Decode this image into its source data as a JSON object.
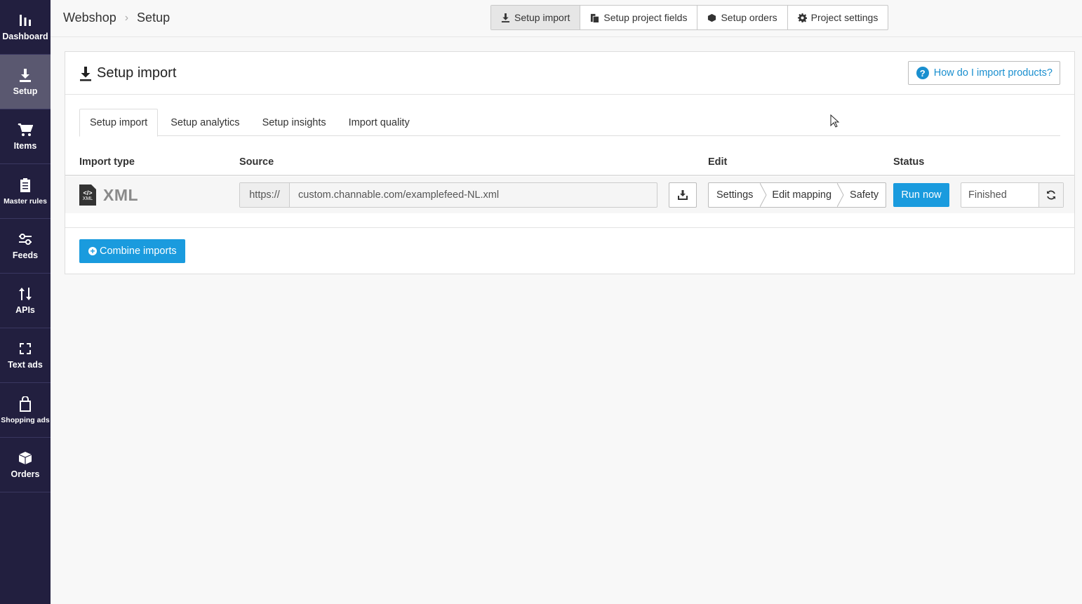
{
  "sidebar": {
    "items": [
      {
        "label": "Dashboard",
        "icon": "bar-chart-icon"
      },
      {
        "label": "Setup",
        "icon": "download-icon",
        "active": true
      },
      {
        "label": "Items",
        "icon": "cart-icon"
      },
      {
        "label": "Master rules",
        "icon": "clipboard-icon"
      },
      {
        "label": "Feeds",
        "icon": "sliders-icon"
      },
      {
        "label": "APIs",
        "icon": "arrows-updown-icon"
      },
      {
        "label": "Text ads",
        "icon": "expand-icon"
      },
      {
        "label": "Shopping ads",
        "icon": "shopping-bag-icon"
      },
      {
        "label": "Orders",
        "icon": "box-icon"
      }
    ]
  },
  "breadcrumb": {
    "root": "Webshop",
    "current": "Setup"
  },
  "topnav": {
    "setup_import": "Setup import",
    "setup_project_fields": "Setup project fields",
    "setup_orders": "Setup orders",
    "project_settings": "Project settings"
  },
  "panel": {
    "title": "Setup import",
    "help_label": "How do I import products?",
    "tabs": [
      "Setup import",
      "Setup analytics",
      "Setup insights",
      "Import quality"
    ],
    "columns": {
      "import_type": "Import type",
      "source": "Source",
      "edit": "Edit",
      "status": "Status"
    },
    "row": {
      "file_code": "</>",
      "file_label": "XML",
      "type": "XML",
      "source_prefix": "https://",
      "source_url": "custom.channable.com/examplefeed-NL.xml",
      "edit_settings": "Settings",
      "edit_mapping": "Edit mapping",
      "edit_safety": "Safety",
      "run_now": "Run now",
      "status": "Finished"
    },
    "combine_label": "Combine imports"
  },
  "colors": {
    "sidebar_bg": "#221f3f",
    "sidebar_active": "#5a5870",
    "accent": "#1a9bde",
    "link": "#1a8fcf"
  }
}
